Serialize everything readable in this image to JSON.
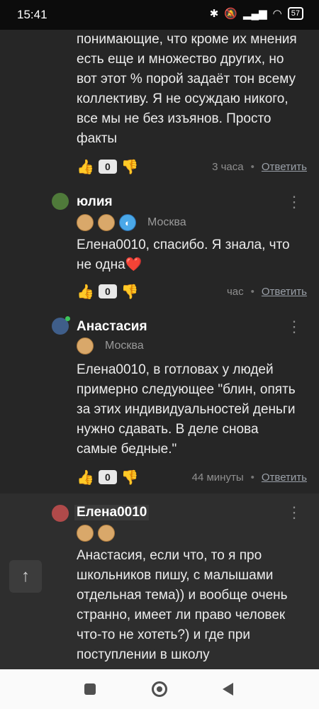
{
  "status_bar": {
    "time": "15:41",
    "battery": "57",
    "icons": [
      "bluetooth-icon",
      "mute-icon",
      "signal-icon",
      "wifi-icon",
      "battery-icon"
    ]
  },
  "comments": [
    {
      "text_lines": [
        "понимающие, что кроме их мнения",
        "есть еще и множество других, но",
        "вот этот % порой задаёт тон всему",
        "коллективу. Я не осуждаю никого,",
        "все мы не без изъянов. Просто",
        "факты"
      ],
      "likes": "0",
      "time": "3 часа",
      "reply": "Ответить"
    },
    {
      "author": "юлия",
      "city": "Москва",
      "text_lines": [
        "Елена0010, спасибо. Я знала, что",
        "не одна❤️"
      ],
      "likes": "0",
      "time": "час",
      "reply": "Ответить"
    },
    {
      "author": "Анастасия",
      "city": "Москва",
      "text_lines": [
        "Елена0010, в готловах у людей",
        "примерно следующее \"блин, опять",
        "за этих индивидуальностей деньги",
        "нужно сдавать. В деле снова",
        "самые бедные.\""
      ],
      "likes": "0",
      "time": "44 минуты",
      "reply": "Ответить"
    },
    {
      "author": "Елена0010",
      "text_lines": [
        "Анастасия, если что, то я про",
        "школьников пишу, с малышами",
        "отдельная тема)) и вообще очень",
        "странно, имеет ли право человек",
        "что-то не хотеть?) и где при",
        "поступлении в школу"
      ]
    }
  ],
  "colors": {
    "background": "#262626",
    "highlight": "#2e2e2e",
    "count_bg": "#e8e8e8",
    "reply_link": "#9aa0a8"
  }
}
